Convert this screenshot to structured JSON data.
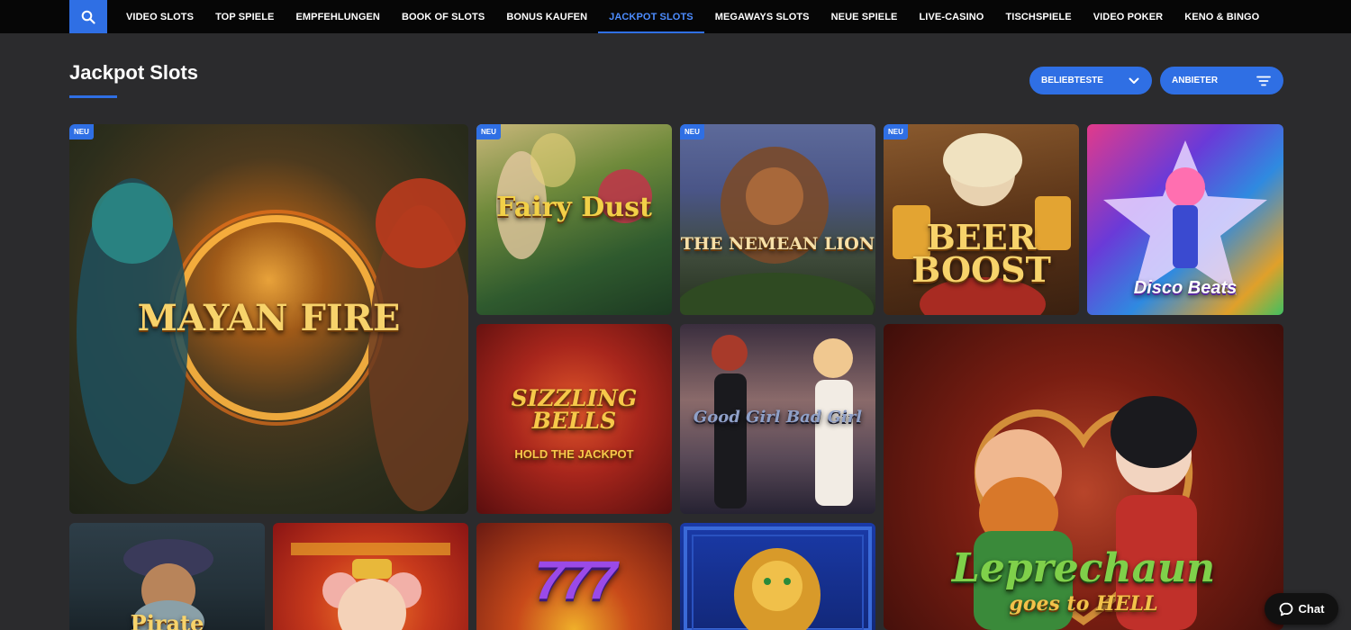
{
  "nav": {
    "search_icon": "search-icon",
    "items": [
      {
        "label": "VIDEO SLOTS",
        "active": false
      },
      {
        "label": "TOP SPIELE",
        "active": false
      },
      {
        "label": "EMPFEHLUNGEN",
        "active": false
      },
      {
        "label": "BOOK OF SLOTS",
        "active": false
      },
      {
        "label": "BONUS KAUFEN",
        "active": false
      },
      {
        "label": "JACKPOT SLOTS",
        "active": true
      },
      {
        "label": "MEGAWAYS SLOTS",
        "active": false
      },
      {
        "label": "NEUE SPIELE",
        "active": false
      },
      {
        "label": "LIVE-CASINO",
        "active": false
      },
      {
        "label": "TISCHSPIELE",
        "active": false
      },
      {
        "label": "VIDEO POKER",
        "active": false
      },
      {
        "label": "KENO & BINGO",
        "active": false
      }
    ]
  },
  "page": {
    "title": "Jackpot Slots"
  },
  "filters": {
    "sort_label": "BELIEBTESTE",
    "sort_icon": "chevron-down-icon",
    "provider_label": "ANBIETER",
    "provider_icon": "filter-icon"
  },
  "badge_label": "NEU",
  "games": [
    {
      "title": "MAYAN FIRE",
      "new": true
    },
    {
      "title": "Fairy Dust",
      "new": true
    },
    {
      "title": "THE NEMEAN LION",
      "new": true
    },
    {
      "title": "BEER BOOST",
      "new": true
    },
    {
      "title": "Disco Beats",
      "new": false
    },
    {
      "title": "SIZZLING BELLS",
      "subtitle": "HOLD THE JACKPOT",
      "new": false
    },
    {
      "title": "Good Girl Bad Girl",
      "new": false
    },
    {
      "title": "Leprechaun",
      "subtitle": "goes to HELL",
      "new": false
    },
    {
      "title": "Pirate",
      "new": false
    },
    {
      "title": "",
      "new": false
    },
    {
      "title": "777",
      "new": false
    },
    {
      "title": "",
      "new": false
    }
  ],
  "chat": {
    "label": "Chat",
    "icon": "chat-bubble-icon"
  },
  "colors": {
    "accent": "#2f6fe4",
    "background": "#2b2b2d",
    "nav_background": "#060606"
  }
}
